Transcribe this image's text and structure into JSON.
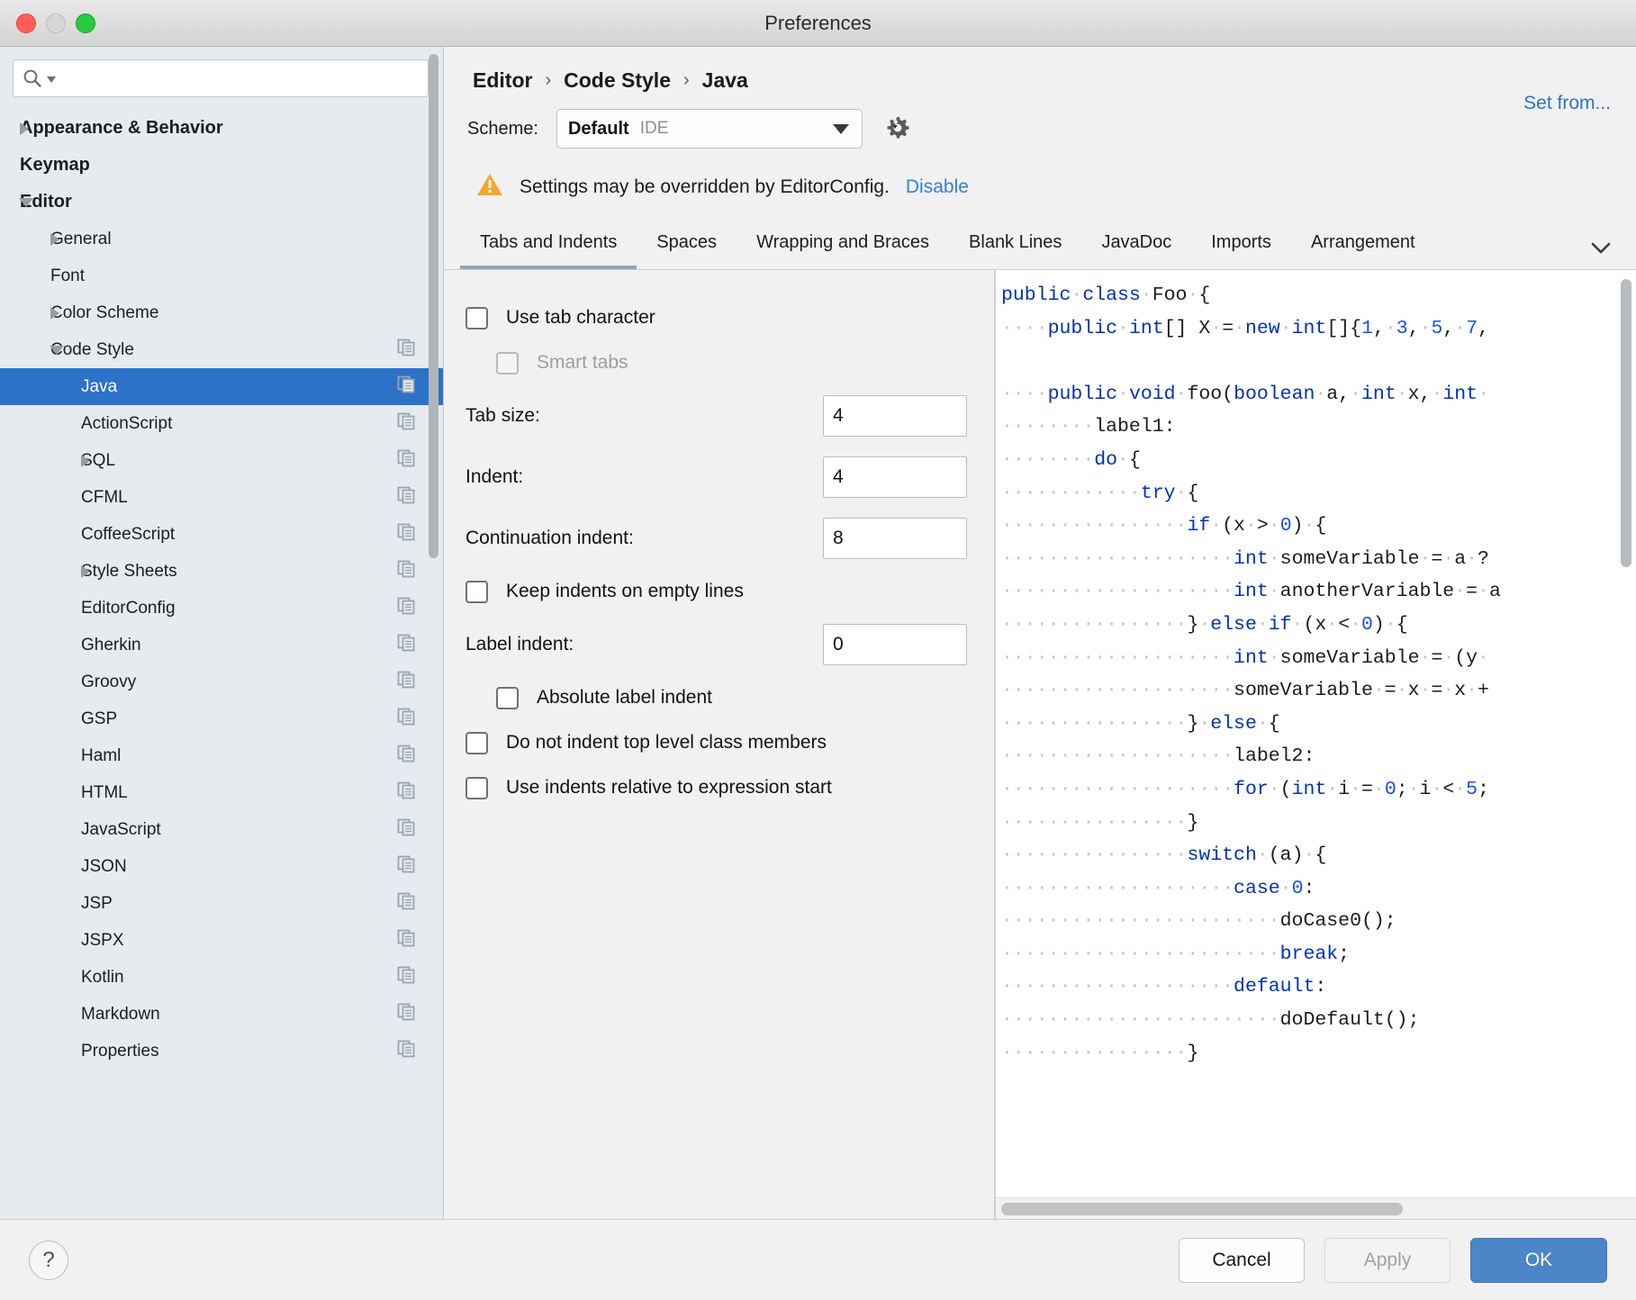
{
  "window": {
    "title": "Preferences"
  },
  "search": {
    "value": "",
    "placeholder": "",
    "icon": "search-icon"
  },
  "sidebar": {
    "items": [
      {
        "label": "Appearance & Behavior",
        "level": 0,
        "arrow": "collapsed",
        "copy": false,
        "selected": false
      },
      {
        "label": "Keymap",
        "level": 0,
        "arrow": "none",
        "copy": false,
        "selected": false
      },
      {
        "label": "Editor",
        "level": 0,
        "arrow": "expanded",
        "copy": false,
        "selected": false
      },
      {
        "label": "General",
        "level": 1,
        "arrow": "collapsed",
        "copy": false,
        "selected": false
      },
      {
        "label": "Font",
        "level": 1,
        "arrow": "none",
        "copy": false,
        "selected": false
      },
      {
        "label": "Color Scheme",
        "level": 1,
        "arrow": "collapsed",
        "copy": false,
        "selected": false
      },
      {
        "label": "Code Style",
        "level": 1,
        "arrow": "expanded",
        "copy": true,
        "selected": false
      },
      {
        "label": "Java",
        "level": 2,
        "arrow": "none",
        "copy": true,
        "selected": true
      },
      {
        "label": "ActionScript",
        "level": 2,
        "arrow": "none",
        "copy": true,
        "selected": false
      },
      {
        "label": "SQL",
        "level": 2,
        "arrow": "collapsed",
        "copy": true,
        "selected": false
      },
      {
        "label": "CFML",
        "level": 2,
        "arrow": "none",
        "copy": true,
        "selected": false
      },
      {
        "label": "CoffeeScript",
        "level": 2,
        "arrow": "none",
        "copy": true,
        "selected": false
      },
      {
        "label": "Style Sheets",
        "level": 2,
        "arrow": "collapsed",
        "copy": true,
        "selected": false
      },
      {
        "label": "EditorConfig",
        "level": 2,
        "arrow": "none",
        "copy": true,
        "selected": false
      },
      {
        "label": "Gherkin",
        "level": 2,
        "arrow": "none",
        "copy": true,
        "selected": false
      },
      {
        "label": "Groovy",
        "level": 2,
        "arrow": "none",
        "copy": true,
        "selected": false
      },
      {
        "label": "GSP",
        "level": 2,
        "arrow": "none",
        "copy": true,
        "selected": false
      },
      {
        "label": "Haml",
        "level": 2,
        "arrow": "none",
        "copy": true,
        "selected": false
      },
      {
        "label": "HTML",
        "level": 2,
        "arrow": "none",
        "copy": true,
        "selected": false
      },
      {
        "label": "JavaScript",
        "level": 2,
        "arrow": "none",
        "copy": true,
        "selected": false
      },
      {
        "label": "JSON",
        "level": 2,
        "arrow": "none",
        "copy": true,
        "selected": false
      },
      {
        "label": "JSP",
        "level": 2,
        "arrow": "none",
        "copy": true,
        "selected": false
      },
      {
        "label": "JSPX",
        "level": 2,
        "arrow": "none",
        "copy": true,
        "selected": false
      },
      {
        "label": "Kotlin",
        "level": 2,
        "arrow": "none",
        "copy": true,
        "selected": false
      },
      {
        "label": "Markdown",
        "level": 2,
        "arrow": "none",
        "copy": true,
        "selected": false
      },
      {
        "label": "Properties",
        "level": 2,
        "arrow": "none",
        "copy": true,
        "selected": false
      }
    ]
  },
  "breadcrumb": {
    "parts": [
      "Editor",
      "Code Style",
      "Java"
    ],
    "separator": "›"
  },
  "scheme": {
    "label": "Scheme:",
    "name": "Default",
    "kind": "IDE",
    "gear_icon": "gear-icon",
    "set_from_label": "Set from..."
  },
  "notice": {
    "icon": "warning-icon",
    "text": "Settings may be overridden by EditorConfig.",
    "link": "Disable"
  },
  "tabs": {
    "items": [
      {
        "label": "Tabs and Indents",
        "active": true
      },
      {
        "label": "Spaces",
        "active": false
      },
      {
        "label": "Wrapping and Braces",
        "active": false
      },
      {
        "label": "Blank Lines",
        "active": false
      },
      {
        "label": "JavaDoc",
        "active": false
      },
      {
        "label": "Imports",
        "active": false
      },
      {
        "label": "Arrangement",
        "active": false
      }
    ],
    "more_icon": "chevron-down-icon"
  },
  "settings": {
    "use_tab_character": {
      "label": "Use tab character",
      "checked": false,
      "disabled": false
    },
    "smart_tabs": {
      "label": "Smart tabs",
      "checked": false,
      "disabled": true
    },
    "tab_size": {
      "label": "Tab size:",
      "value": "4"
    },
    "indent": {
      "label": "Indent:",
      "value": "4"
    },
    "continuation_indent": {
      "label": "Continuation indent:",
      "value": "8"
    },
    "keep_indents_on_empty_lines": {
      "label": "Keep indents on empty lines",
      "checked": false
    },
    "label_indent": {
      "label": "Label indent:",
      "value": "0"
    },
    "absolute_label_indent": {
      "label": "Absolute label indent",
      "checked": false
    },
    "do_not_indent_top_level": {
      "label": "Do not indent top level class members",
      "checked": false
    },
    "use_indents_relative": {
      "label": "Use indents relative to expression start",
      "checked": false
    }
  },
  "preview": {
    "lines": [
      [
        {
          "t": "public",
          "c": "kw"
        },
        {
          "t": " ",
          "c": "ws"
        },
        {
          "t": "class",
          "c": "kw"
        },
        {
          "t": " ",
          "c": "ws"
        },
        {
          "t": "Foo",
          "c": ""
        },
        {
          "t": " ",
          "c": "ws"
        },
        {
          "t": "{",
          "c": ""
        }
      ],
      [
        {
          "t": "    ",
          "c": "ws"
        },
        {
          "t": "public",
          "c": "kw"
        },
        {
          "t": " ",
          "c": "ws"
        },
        {
          "t": "int",
          "c": "kw"
        },
        {
          "t": "[] ",
          "c": ""
        },
        {
          "t": "X",
          "c": ""
        },
        {
          "t": " ",
          "c": "ws"
        },
        {
          "t": "=",
          "c": ""
        },
        {
          "t": " ",
          "c": "ws"
        },
        {
          "t": "new",
          "c": "kw"
        },
        {
          "t": " ",
          "c": "ws"
        },
        {
          "t": "int",
          "c": "kw"
        },
        {
          "t": "[]{",
          "c": ""
        },
        {
          "t": "1",
          "c": "num"
        },
        {
          "t": ",",
          "c": ""
        },
        {
          "t": " ",
          "c": "ws"
        },
        {
          "t": "3",
          "c": "num"
        },
        {
          "t": ",",
          "c": ""
        },
        {
          "t": " ",
          "c": "ws"
        },
        {
          "t": "5",
          "c": "num"
        },
        {
          "t": ",",
          "c": ""
        },
        {
          "t": " ",
          "c": "ws"
        },
        {
          "t": "7",
          "c": "num"
        },
        {
          "t": ",",
          "c": ""
        }
      ],
      [],
      [
        {
          "t": "    ",
          "c": "ws"
        },
        {
          "t": "public",
          "c": "kw"
        },
        {
          "t": " ",
          "c": "ws"
        },
        {
          "t": "void",
          "c": "kw"
        },
        {
          "t": " ",
          "c": "ws"
        },
        {
          "t": "foo(",
          "c": ""
        },
        {
          "t": "boolean",
          "c": "kw"
        },
        {
          "t": " ",
          "c": "ws"
        },
        {
          "t": "a,",
          "c": ""
        },
        {
          "t": " ",
          "c": "ws"
        },
        {
          "t": "int",
          "c": "kw"
        },
        {
          "t": " ",
          "c": "ws"
        },
        {
          "t": "x,",
          "c": ""
        },
        {
          "t": " ",
          "c": "ws"
        },
        {
          "t": "int",
          "c": "kw"
        },
        {
          "t": " ",
          "c": "ws"
        }
      ],
      [
        {
          "t": "        ",
          "c": "ws"
        },
        {
          "t": "label1:",
          "c": ""
        }
      ],
      [
        {
          "t": "        ",
          "c": "ws"
        },
        {
          "t": "do",
          "c": "kw"
        },
        {
          "t": " ",
          "c": "ws"
        },
        {
          "t": "{",
          "c": ""
        }
      ],
      [
        {
          "t": "            ",
          "c": "ws"
        },
        {
          "t": "try",
          "c": "kw"
        },
        {
          "t": " ",
          "c": "ws"
        },
        {
          "t": "{",
          "c": ""
        }
      ],
      [
        {
          "t": "                ",
          "c": "ws"
        },
        {
          "t": "if",
          "c": "kw"
        },
        {
          "t": " ",
          "c": "ws"
        },
        {
          "t": "(x",
          "c": ""
        },
        {
          "t": " ",
          "c": "ws"
        },
        {
          "t": ">",
          "c": ""
        },
        {
          "t": " ",
          "c": "ws"
        },
        {
          "t": "0",
          "c": "num"
        },
        {
          "t": ")",
          "c": ""
        },
        {
          "t": " ",
          "c": "ws"
        },
        {
          "t": "{",
          "c": ""
        }
      ],
      [
        {
          "t": "                    ",
          "c": "ws"
        },
        {
          "t": "int",
          "c": "kw"
        },
        {
          "t": " ",
          "c": "ws"
        },
        {
          "t": "someVariable",
          "c": ""
        },
        {
          "t": " ",
          "c": "ws"
        },
        {
          "t": "=",
          "c": ""
        },
        {
          "t": " ",
          "c": "ws"
        },
        {
          "t": "a",
          "c": ""
        },
        {
          "t": " ",
          "c": "ws"
        },
        {
          "t": "?",
          "c": ""
        }
      ],
      [
        {
          "t": "                    ",
          "c": "ws"
        },
        {
          "t": "int",
          "c": "kw"
        },
        {
          "t": " ",
          "c": "ws"
        },
        {
          "t": "anotherVariable",
          "c": ""
        },
        {
          "t": " ",
          "c": "ws"
        },
        {
          "t": "=",
          "c": ""
        },
        {
          "t": " ",
          "c": "ws"
        },
        {
          "t": "a",
          "c": ""
        }
      ],
      [
        {
          "t": "                ",
          "c": "ws"
        },
        {
          "t": "}",
          "c": ""
        },
        {
          "t": " ",
          "c": "ws"
        },
        {
          "t": "else",
          "c": "kw"
        },
        {
          "t": " ",
          "c": "ws"
        },
        {
          "t": "if",
          "c": "kw"
        },
        {
          "t": " ",
          "c": "ws"
        },
        {
          "t": "(x",
          "c": ""
        },
        {
          "t": " ",
          "c": "ws"
        },
        {
          "t": "<",
          "c": ""
        },
        {
          "t": " ",
          "c": "ws"
        },
        {
          "t": "0",
          "c": "num"
        },
        {
          "t": ")",
          "c": ""
        },
        {
          "t": " ",
          "c": "ws"
        },
        {
          "t": "{",
          "c": ""
        }
      ],
      [
        {
          "t": "                    ",
          "c": "ws"
        },
        {
          "t": "int",
          "c": "kw"
        },
        {
          "t": " ",
          "c": "ws"
        },
        {
          "t": "someVariable",
          "c": ""
        },
        {
          "t": " ",
          "c": "ws"
        },
        {
          "t": "=",
          "c": ""
        },
        {
          "t": " ",
          "c": "ws"
        },
        {
          "t": "(y",
          "c": ""
        },
        {
          "t": " ",
          "c": "ws"
        }
      ],
      [
        {
          "t": "                    ",
          "c": "ws"
        },
        {
          "t": "someVariable",
          "c": ""
        },
        {
          "t": " ",
          "c": "ws"
        },
        {
          "t": "=",
          "c": ""
        },
        {
          "t": " ",
          "c": "ws"
        },
        {
          "t": "x",
          "c": ""
        },
        {
          "t": " ",
          "c": "ws"
        },
        {
          "t": "=",
          "c": ""
        },
        {
          "t": " ",
          "c": "ws"
        },
        {
          "t": "x",
          "c": ""
        },
        {
          "t": " ",
          "c": "ws"
        },
        {
          "t": "+",
          "c": ""
        }
      ],
      [
        {
          "t": "                ",
          "c": "ws"
        },
        {
          "t": "}",
          "c": ""
        },
        {
          "t": " ",
          "c": "ws"
        },
        {
          "t": "else",
          "c": "kw"
        },
        {
          "t": " ",
          "c": "ws"
        },
        {
          "t": "{",
          "c": ""
        }
      ],
      [
        {
          "t": "                    ",
          "c": "ws"
        },
        {
          "t": "label2:",
          "c": ""
        }
      ],
      [
        {
          "t": "                    ",
          "c": "ws"
        },
        {
          "t": "for",
          "c": "kw"
        },
        {
          "t": " ",
          "c": "ws"
        },
        {
          "t": "(",
          "c": ""
        },
        {
          "t": "int",
          "c": "kw"
        },
        {
          "t": " ",
          "c": "ws"
        },
        {
          "t": "i",
          "c": ""
        },
        {
          "t": " ",
          "c": "ws"
        },
        {
          "t": "=",
          "c": ""
        },
        {
          "t": " ",
          "c": "ws"
        },
        {
          "t": "0",
          "c": "num"
        },
        {
          "t": ";",
          "c": ""
        },
        {
          "t": " ",
          "c": "ws"
        },
        {
          "t": "i",
          "c": ""
        },
        {
          "t": " ",
          "c": "ws"
        },
        {
          "t": "<",
          "c": ""
        },
        {
          "t": " ",
          "c": "ws"
        },
        {
          "t": "5",
          "c": "num"
        },
        {
          "t": ";",
          "c": ""
        }
      ],
      [
        {
          "t": "                ",
          "c": "ws"
        },
        {
          "t": "}",
          "c": ""
        }
      ],
      [
        {
          "t": "                ",
          "c": "ws"
        },
        {
          "t": "switch",
          "c": "kw"
        },
        {
          "t": " ",
          "c": "ws"
        },
        {
          "t": "(a)",
          "c": ""
        },
        {
          "t": " ",
          "c": "ws"
        },
        {
          "t": "{",
          "c": ""
        }
      ],
      [
        {
          "t": "                    ",
          "c": "ws"
        },
        {
          "t": "case",
          "c": "kw"
        },
        {
          "t": " ",
          "c": "ws"
        },
        {
          "t": "0",
          "c": "num"
        },
        {
          "t": ":",
          "c": ""
        }
      ],
      [
        {
          "t": "                        ",
          "c": "ws"
        },
        {
          "t": "doCase0();",
          "c": ""
        }
      ],
      [
        {
          "t": "                        ",
          "c": "ws"
        },
        {
          "t": "break",
          "c": "kw"
        },
        {
          "t": ";",
          "c": ""
        }
      ],
      [
        {
          "t": "                    ",
          "c": "ws"
        },
        {
          "t": "default",
          "c": "kw"
        },
        {
          "t": ":",
          "c": ""
        }
      ],
      [
        {
          "t": "                        ",
          "c": "ws"
        },
        {
          "t": "doDefault();",
          "c": ""
        }
      ],
      [
        {
          "t": "                ",
          "c": "ws"
        },
        {
          "t": "}",
          "c": ""
        }
      ]
    ]
  },
  "footer": {
    "help_label": "?",
    "cancel_label": "Cancel",
    "apply_label": "Apply",
    "ok_label": "OK"
  },
  "colors": {
    "selection_blue": "#2b72c8",
    "ok_blue": "#4a86c8",
    "link_blue": "#3581d6",
    "warning_amber": "#f0a732",
    "keyword_blue": "#0033b3"
  }
}
